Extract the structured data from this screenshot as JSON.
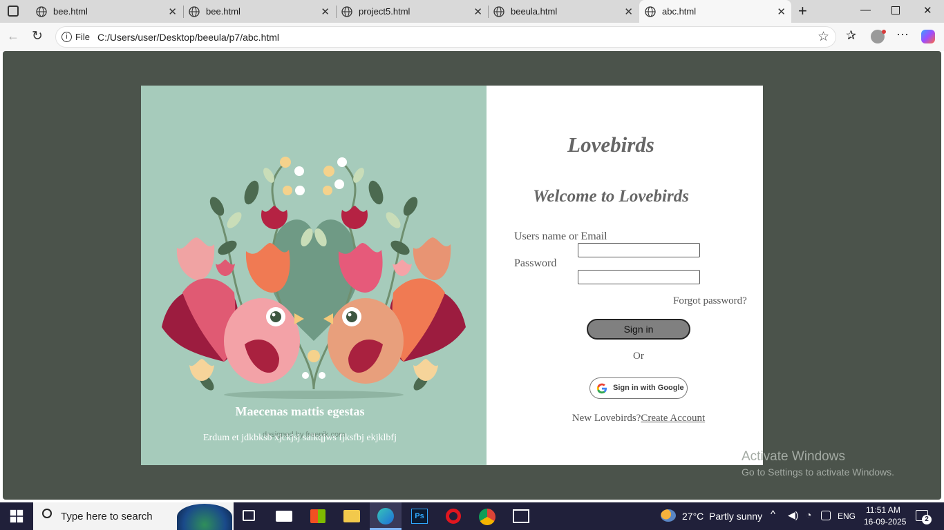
{
  "browser": {
    "tabs": [
      {
        "label": "bee.html"
      },
      {
        "label": "bee.html"
      },
      {
        "label": "project5.html"
      },
      {
        "label": "beeula.html"
      },
      {
        "label": "abc.html",
        "active": true
      }
    ],
    "address": {
      "scheme": "File",
      "url": "C:/Users/user/Desktop/beeula/p7/abc.html"
    }
  },
  "left": {
    "heading": "Maecenas mattis egestas",
    "subtext": "Erdum et jdkbksb xjckjsj salkqjws fjksfbj ekjklbfj",
    "credit": "designed by freepik.com"
  },
  "login": {
    "brand": "Lovebirds",
    "welcome": "Welcome to Lovebirds",
    "user_label": "Users name or Email",
    "password_label": "Password",
    "forgot": "Forgot password?",
    "signin": "Sign in",
    "or": "Or",
    "google": "Sign in with Google",
    "new_text": "New Lovebirds?",
    "create": "Create Account"
  },
  "overlay": {
    "title": "Activate Windows",
    "subtitle": "Go to Settings to activate Windows."
  },
  "taskbar": {
    "search": "Type here to search",
    "weather": "27°C  Partly sunny",
    "lang": "ENG",
    "time": "11:51 AM",
    "date": "16-09-2025",
    "notifications": "2"
  },
  "colors": {
    "page_bg": "#4b534b",
    "panel_left": "#a6cbbb",
    "accent_pink": "#e05a73",
    "signin_bg": "#808080"
  }
}
